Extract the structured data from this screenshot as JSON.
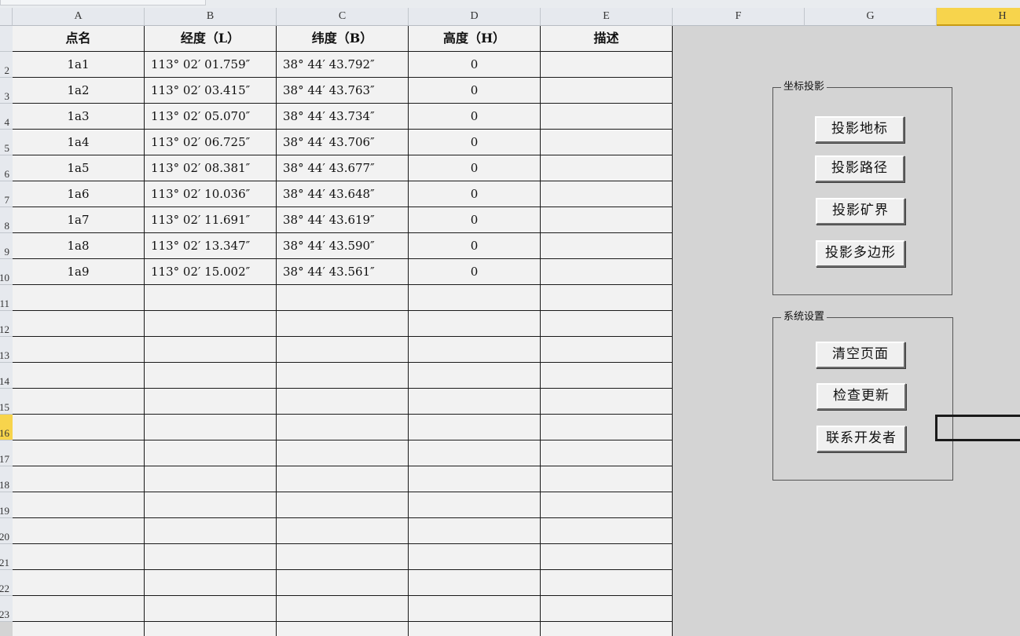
{
  "columns": [
    "A",
    "B",
    "C",
    "D",
    "E",
    "F",
    "G",
    "H"
  ],
  "selected_column": "H",
  "row_numbers": [
    "2",
    "3",
    "4",
    "5",
    "6",
    "7",
    "8",
    "9",
    "10",
    "11",
    "12",
    "13",
    "14",
    "15",
    "16",
    "17",
    "18",
    "19",
    "20",
    "21",
    "22",
    "23"
  ],
  "selected_row": "16",
  "table": {
    "headers": [
      "点名",
      "经度（L）",
      "纬度（B）",
      "高度（H）",
      "描述"
    ],
    "rows": [
      [
        "1a1",
        "113° 02′ 01.759″",
        "38° 44′ 43.792″",
        "0",
        ""
      ],
      [
        "1a2",
        "113° 02′ 03.415″",
        "38° 44′ 43.763″",
        "0",
        ""
      ],
      [
        "1a3",
        "113° 02′ 05.070″",
        "38° 44′ 43.734″",
        "0",
        ""
      ],
      [
        "1a4",
        "113° 02′ 06.725″",
        "38° 44′ 43.706″",
        "0",
        ""
      ],
      [
        "1a5",
        "113° 02′ 08.381″",
        "38° 44′ 43.677″",
        "0",
        ""
      ],
      [
        "1a6",
        "113° 02′ 10.036″",
        "38° 44′ 43.648″",
        "0",
        ""
      ],
      [
        "1a7",
        "113° 02′ 11.691″",
        "38° 44′ 43.619″",
        "0",
        ""
      ],
      [
        "1a8",
        "113° 02′ 13.347″",
        "38° 44′ 43.590″",
        "0",
        ""
      ],
      [
        "1a9",
        "113° 02′ 15.002″",
        "38° 44′ 43.561″",
        "0",
        ""
      ]
    ]
  },
  "panels": {
    "projection": {
      "title": "坐标投影",
      "buttons": [
        "投影地标",
        "投影路径",
        "投影矿界",
        "投影多边形"
      ]
    },
    "settings": {
      "title": "系统设置",
      "buttons": [
        "清空页面",
        "检查更新",
        "联系开发者"
      ]
    }
  }
}
